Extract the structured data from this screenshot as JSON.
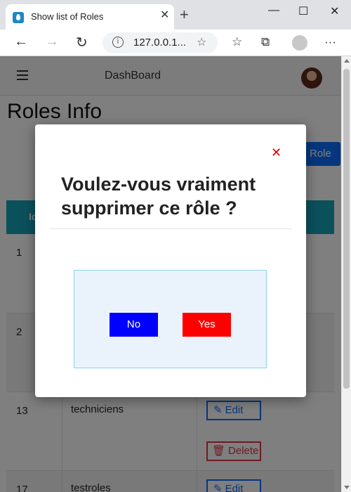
{
  "browser": {
    "tab_title": "Show list of Roles",
    "tab_close": "✕",
    "new_tab": "+",
    "url": "127.0.0.1...",
    "menu": "···"
  },
  "navbar": {
    "brand": "DashBoard"
  },
  "page": {
    "title": "Roles Info",
    "add_button": "Role",
    "table": {
      "headers": [
        "Id"
      ],
      "rows": [
        {
          "id": "1",
          "name": ""
        },
        {
          "id": "2",
          "name": ""
        },
        {
          "id": "13",
          "name": "techniciens",
          "edit_label": "Edit",
          "delete_label": "Delete"
        },
        {
          "id": "17",
          "name": "testroles",
          "edit_label": "Edit"
        }
      ]
    }
  },
  "modal": {
    "close": "✕",
    "title": "Voulez-vous vraiment supprimer ce rôle ?",
    "no_label": "No",
    "yes_label": "Yes"
  },
  "colors": {
    "table_header": "#17a2b8",
    "no_button": "#0000ff",
    "yes_button": "#ff0000",
    "close_icon": "#e00000"
  }
}
